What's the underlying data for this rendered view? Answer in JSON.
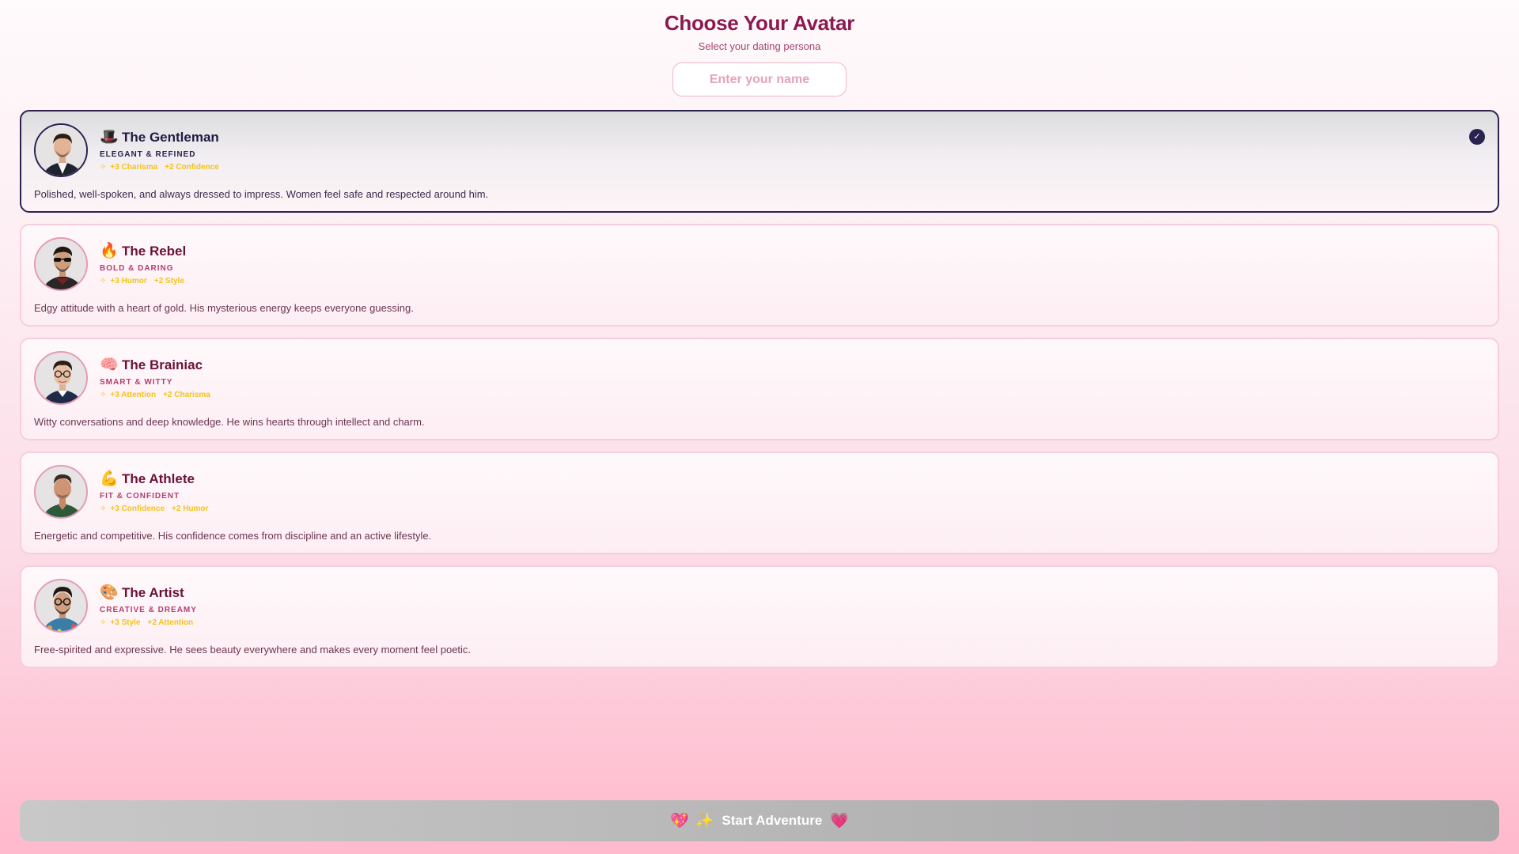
{
  "header": {
    "title": "Choose Your Avatar",
    "subtitle": "Select your dating persona"
  },
  "name_input": {
    "placeholder": "Enter your name",
    "value": ""
  },
  "avatars": [
    {
      "emoji": "🎩",
      "name": "The Gentleman",
      "tagline": "ELEGANT & REFINED",
      "stats": [
        "+3 Charisma",
        "+2 Confidence"
      ],
      "description": "Polished, well-spoken, and always dressed to impress. Women feel safe and respected around him.",
      "selected": true
    },
    {
      "emoji": "🔥",
      "name": "The Rebel",
      "tagline": "BOLD & DARING",
      "stats": [
        "+3 Humor",
        "+2 Style"
      ],
      "description": "Edgy attitude with a heart of gold. His mysterious energy keeps everyone guessing.",
      "selected": false
    },
    {
      "emoji": "🧠",
      "name": "The Brainiac",
      "tagline": "SMART & WITTY",
      "stats": [
        "+3 Attention",
        "+2 Charisma"
      ],
      "description": "Witty conversations and deep knowledge. He wins hearts through intellect and charm.",
      "selected": false
    },
    {
      "emoji": "💪",
      "name": "The Athlete",
      "tagline": "FIT & CONFIDENT",
      "stats": [
        "+3 Confidence",
        "+2 Humor"
      ],
      "description": "Energetic and competitive. His confidence comes from discipline and an active lifestyle.",
      "selected": false
    },
    {
      "emoji": "🎨",
      "name": "The Artist",
      "tagline": "CREATIVE & DREAMY",
      "stats": [
        "+3 Style",
        "+2 Attention"
      ],
      "description": "Free-spirited and expressive. He sees beauty everywhere and makes every moment feel poetic.",
      "selected": false
    }
  ],
  "icons": {
    "selected_check": "✓",
    "stat_sparkle": "✧",
    "start_heart_left": "💖",
    "start_sparkle": "✨",
    "start_heart_right": "💗"
  },
  "start_button": {
    "label": "Start Adventure",
    "enabled": false
  },
  "colors": {
    "primary": "#8b1a4f",
    "selected_border": "#2a2250",
    "stat_gold": "#f4c21a",
    "disabled_button": "#b8b7b8"
  }
}
